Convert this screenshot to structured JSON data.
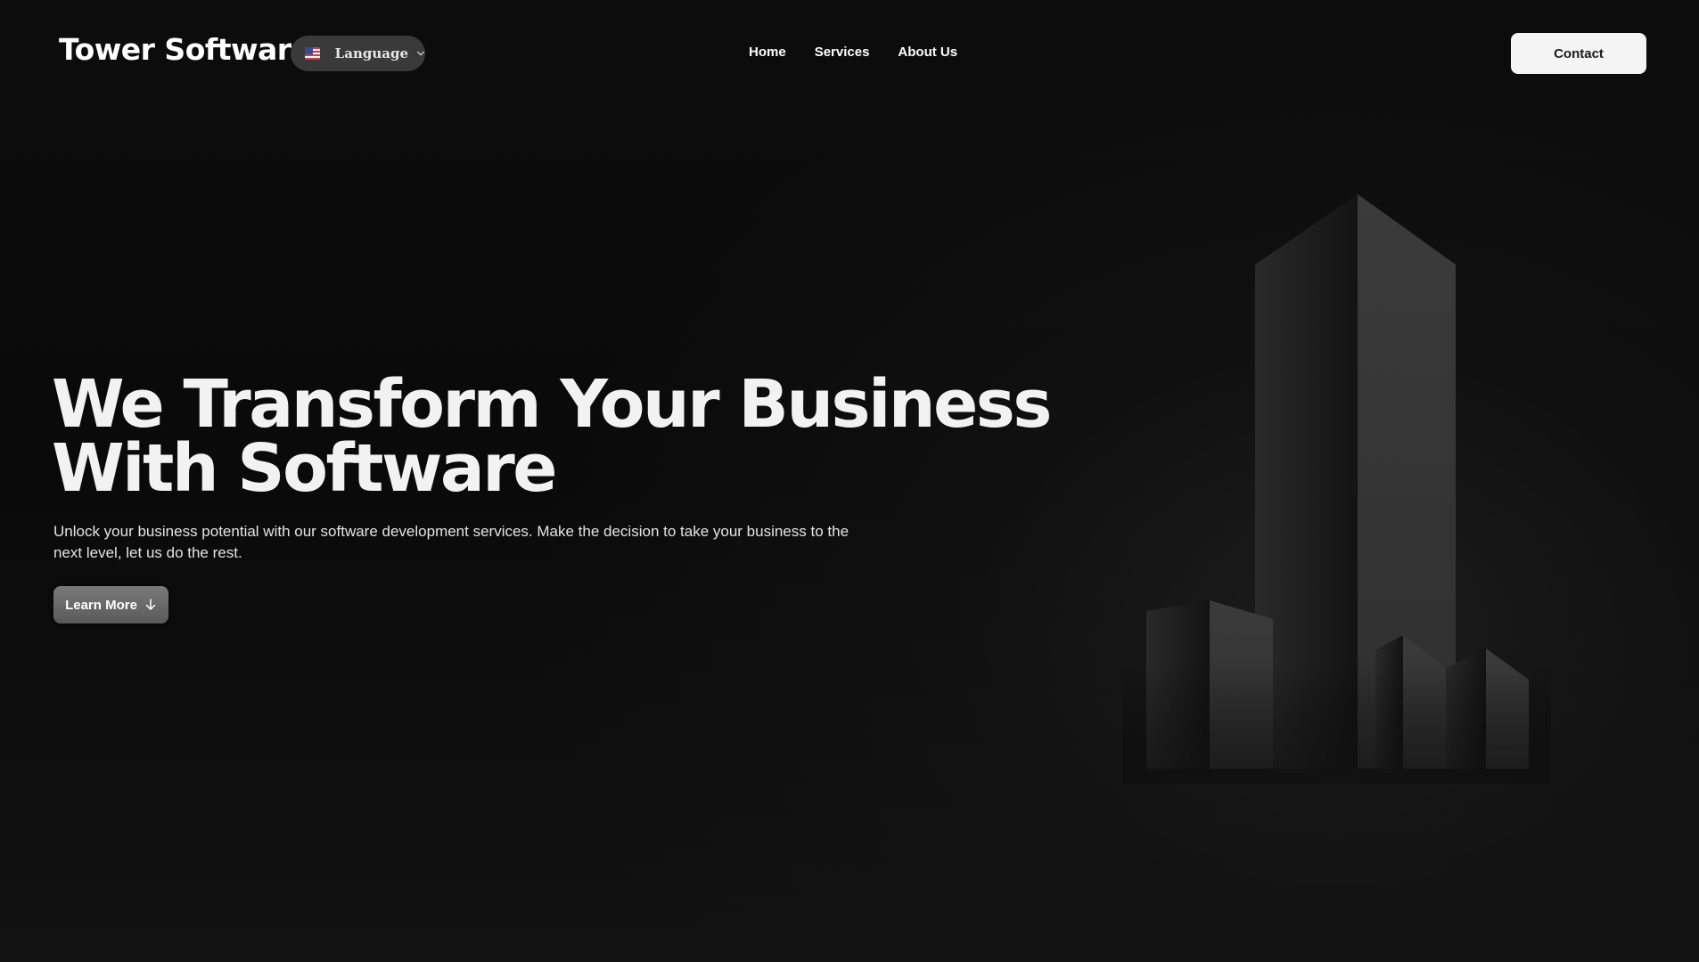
{
  "header": {
    "logo": "Tower Software",
    "language": {
      "label": "Language",
      "flag_icon": "us-flag-icon",
      "chevron_icon": "chevron-down-icon"
    },
    "nav": [
      {
        "label": "Home"
      },
      {
        "label": "Services"
      },
      {
        "label": "About Us"
      }
    ],
    "contact_label": "Contact"
  },
  "hero": {
    "title_line1": "We Transform Your Business",
    "title_line2": "With Software",
    "subtitle": "Unlock your business potential with our software development services. Make the decision to take your business to the next level, let us do the rest.",
    "cta_label": "Learn More",
    "cta_icon": "arrow-down-icon"
  },
  "colors": {
    "background": "#0b0b0b",
    "text": "#f2f2f2",
    "language_pill": "#3a3a3a",
    "contact_button": "#f4f4f4",
    "cta_button": "#6a6a6a"
  }
}
